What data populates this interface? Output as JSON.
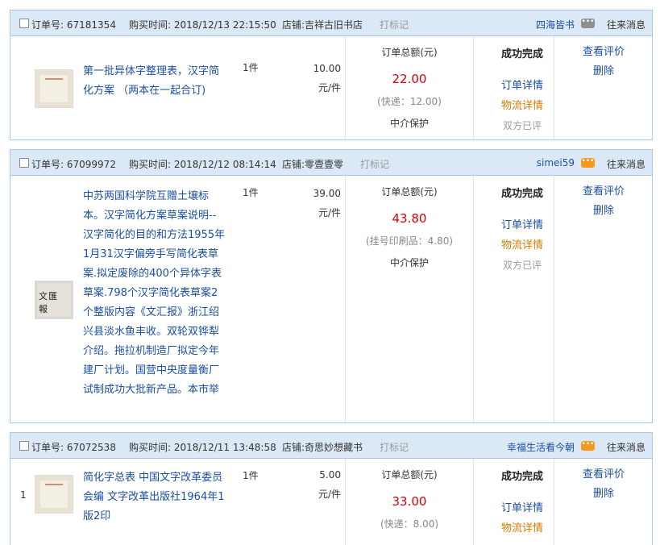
{
  "labels": {
    "order_no": "订单号:",
    "buy_time": "购买时间:",
    "shop": "店铺:",
    "mark": "打标记",
    "messages": "往来消息",
    "total_label": "订单总额(元)",
    "escrow": "中介保护",
    "status": "成功完成",
    "detail": "订单详情",
    "logistics": "物流详情",
    "rated": "双方已评",
    "review": "查看评价",
    "delete": "删除"
  },
  "orders": [
    {
      "order_no": "67181354",
      "buy_time": "2018/12/13 22:15:50",
      "shop": "吉祥古旧书店",
      "seller": "四海皆书",
      "title": "第一批异体字整理表，汉字简化方案 （两本在一起合订)",
      "qty": "1件",
      "price": "10.00",
      "unit": "元/件",
      "total": "22.00",
      "shipping": "(快递：12.00)"
    },
    {
      "order_no": "67099972",
      "buy_time": "2018/12/12 08:14:14",
      "shop": "零壹壹零",
      "seller": "simei59",
      "title": "中苏两国科学院互赠土壤标本。汉字简化方案草案说明--汉字简化的目的和方法1955年1月31汉字偏旁手写简化表草案.拟定废除的400个异体字表草案.798个汉字简化表草案2个整版内容《文汇报》浙江绍兴县淡水鱼丰收。双轮双铧犁介绍。拖拉机制造厂拟定今年建厂计划。国营中央度量衡厂试制成功大批新产品。本市举",
      "qty": "1件",
      "price": "39.00",
      "unit": "元/件",
      "total": "43.80",
      "shipping": "(挂号印刷品：4.80)"
    },
    {
      "order_no": "67072538",
      "buy_time": "2018/12/11 13:48:58",
      "shop": "奇思妙想藏书",
      "seller": "幸福生活看今朝",
      "title": "简化字总表 中国文字改革委员会编 文字改革出版社1964年1版2印",
      "qty": "1件",
      "price": "5.00",
      "unit": "元/件",
      "total": "33.00",
      "shipping": "(快递：8.00)",
      "row_index": "1"
    }
  ]
}
